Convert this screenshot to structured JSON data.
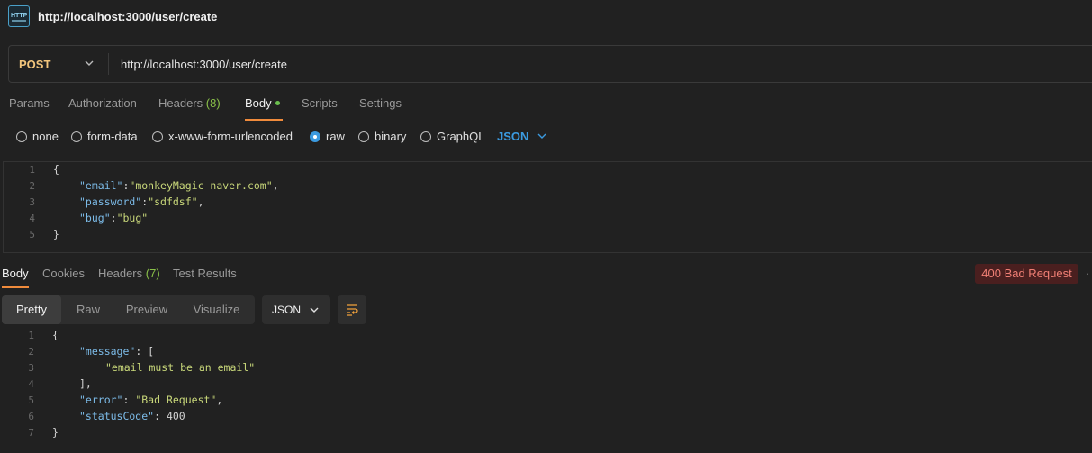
{
  "header": {
    "icon": "http-icon",
    "title": "http://localhost:3000/user/create"
  },
  "request": {
    "method": "POST",
    "url": "http://localhost:3000/user/create",
    "tabs": [
      {
        "label": "Params"
      },
      {
        "label": "Authorization"
      },
      {
        "label": "Headers",
        "count": "(8)"
      },
      {
        "label": "Body",
        "active": true
      },
      {
        "label": "Scripts"
      },
      {
        "label": "Settings"
      }
    ],
    "body_types": [
      "none",
      "form-data",
      "x-www-form-urlencoded",
      "raw",
      "binary",
      "GraphQL"
    ],
    "selected_body_type": "raw",
    "body_format": "JSON",
    "body_lines": [
      {
        "n": "1",
        "text": "{"
      },
      {
        "n": "2",
        "key": "\"email\"",
        "value": "\"monkeyMagic naver.com\"",
        "trail": ","
      },
      {
        "n": "3",
        "key": "\"password\"",
        "value": "\"sdfdsf\"",
        "trail": ","
      },
      {
        "n": "4",
        "key": "\"bug\"",
        "value": "\"bug\"",
        "trail": ""
      },
      {
        "n": "5",
        "text": "}"
      }
    ]
  },
  "response": {
    "tabs": [
      {
        "label": "Body",
        "active": true
      },
      {
        "label": "Cookies"
      },
      {
        "label": "Headers",
        "count": "(7)"
      },
      {
        "label": "Test Results"
      }
    ],
    "status": "400 Bad Request",
    "more": "·",
    "views": [
      "Pretty",
      "Raw",
      "Preview",
      "Visualize"
    ],
    "active_view": "Pretty",
    "format": "JSON",
    "lines": [
      {
        "n": "1",
        "t": "{"
      },
      {
        "n": "2",
        "key": "\"message\"",
        "rest": ": ["
      },
      {
        "n": "3",
        "str": "\"email must be an email\""
      },
      {
        "n": "4",
        "t": "],"
      },
      {
        "n": "5",
        "key": "\"error\"",
        "rest": ": ",
        "str": "\"Bad Request\"",
        "trail": ","
      },
      {
        "n": "6",
        "key": "\"statusCode\"",
        "rest": ": ",
        "num": "400"
      },
      {
        "n": "7",
        "t": "}"
      }
    ]
  },
  "colors": {
    "method": "#f2c57c",
    "accent": "#f08b3c",
    "link": "#3b9ae0",
    "error_bg": "#4a1f1f",
    "error_text": "#f07f75"
  }
}
